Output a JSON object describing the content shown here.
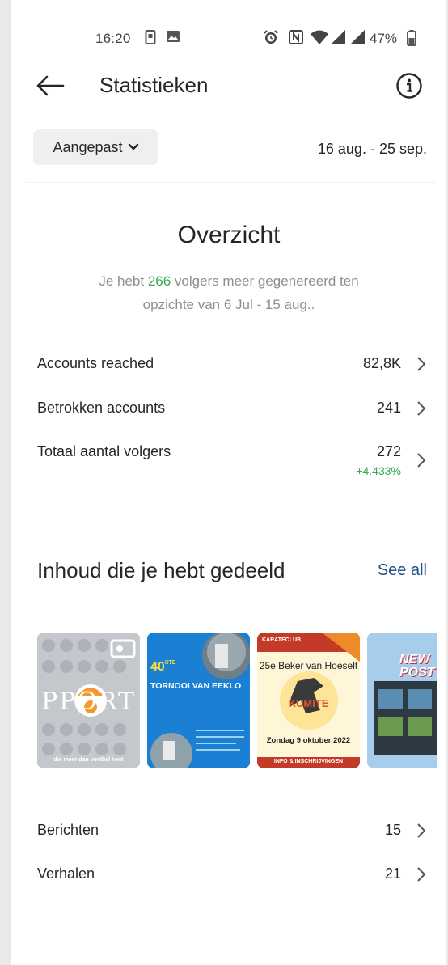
{
  "status_bar": {
    "time": "16:20",
    "battery": "47%"
  },
  "header": {
    "title": "Statistieken"
  },
  "filter": {
    "range_label": "Aangepast",
    "date_range": "16 aug. - 25 sep."
  },
  "overview": {
    "title": "Overzicht",
    "summary_prefix": "Je hebt ",
    "summary_number": "266",
    "summary_suffix": " volgers meer gegenereerd ten opzichte van 6 Jul - 15 aug..",
    "rows": [
      {
        "label": "Accounts reached",
        "value": "82,8K"
      },
      {
        "label": "Betrokken accounts",
        "value": "241"
      },
      {
        "label": "Totaal aantal volgers",
        "value": "272",
        "change": "+4.433%"
      }
    ]
  },
  "content": {
    "title": "Inhoud die je hebt gedeeld",
    "see_all": "See all",
    "thumbs": [
      {
        "text_main": "PPORT",
        "text_bottom": "die meer dan voetbal kent"
      },
      {
        "text_big": "40",
        "text_sup": "STE",
        "text_main": "TORNOOI VAN EEKLO"
      },
      {
        "text_top": "KARATECLUB",
        "text_title": "25e Beker van Hoeselt",
        "text_kumite": "KUMITE",
        "text_date": "Zondag 9 oktober 2022",
        "text_foot": "INFO & INSCHRIJVINGEN"
      },
      {
        "text_main": "NEW POST"
      }
    ],
    "rows": [
      {
        "label": "Berichten",
        "value": "15"
      },
      {
        "label": "Verhalen",
        "value": "21"
      }
    ]
  },
  "colors": {
    "accent_green": "#34a853",
    "link_blue": "#1f4f86"
  }
}
